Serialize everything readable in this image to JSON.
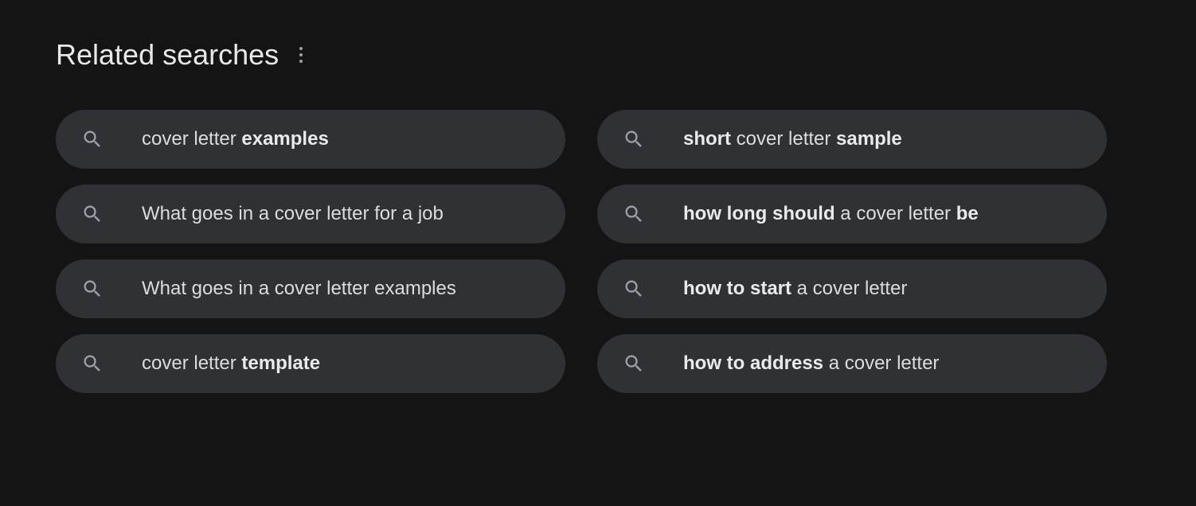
{
  "header": {
    "title": "Related searches"
  },
  "searches": [
    {
      "parts": [
        {
          "text": "cover letter ",
          "bold": false
        },
        {
          "text": "examples",
          "bold": true
        }
      ]
    },
    {
      "parts": [
        {
          "text": "short",
          "bold": true
        },
        {
          "text": " cover letter ",
          "bold": false
        },
        {
          "text": "sample",
          "bold": true
        }
      ]
    },
    {
      "parts": [
        {
          "text": "What goes in a cover letter for a job",
          "bold": false
        }
      ]
    },
    {
      "parts": [
        {
          "text": "how long should",
          "bold": true
        },
        {
          "text": " a cover letter ",
          "bold": false
        },
        {
          "text": "be",
          "bold": true
        }
      ]
    },
    {
      "parts": [
        {
          "text": "What goes in a cover letter examples",
          "bold": false
        }
      ]
    },
    {
      "parts": [
        {
          "text": "how to start",
          "bold": true
        },
        {
          "text": " a cover letter",
          "bold": false
        }
      ]
    },
    {
      "parts": [
        {
          "text": "cover letter ",
          "bold": false
        },
        {
          "text": "template",
          "bold": true
        }
      ]
    },
    {
      "parts": [
        {
          "text": "how to address",
          "bold": true
        },
        {
          "text": " a cover letter",
          "bold": false
        }
      ]
    }
  ]
}
